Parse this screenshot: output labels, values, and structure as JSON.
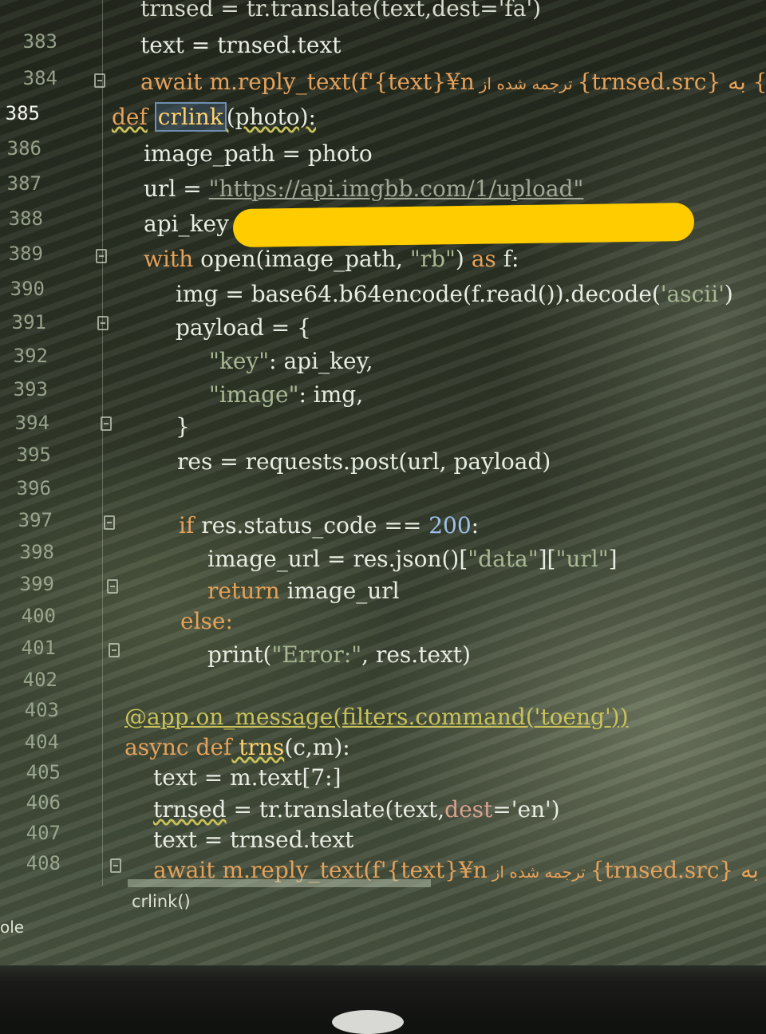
{
  "editor": {
    "line_numbers": [
      "383",
      "384",
      "385",
      "386",
      "387",
      "388",
      "389",
      "390",
      "391",
      "392",
      "393",
      "394",
      "395",
      "396",
      "397",
      "398",
      "399",
      "400",
      "401",
      "402",
      "403",
      "404",
      "405",
      "406",
      "407",
      "408"
    ],
    "lines": {
      "l382": "trnsed = tr.translate(text,dest='fa')",
      "l383": "text = trnsed.text",
      "l384_a": "await m.reply_text(f'{text}¥n",
      "l384_b": "ترجمه شده از",
      "l384_c": "{trnsed.src} به {tr",
      "l385_def": "def",
      "l385_name": "crlink",
      "l385_rest": "(photo):",
      "l386": "image_path = photo",
      "l387_a": "url = ",
      "l387_b": "\"https://api.imgbb.com/1/upload\"",
      "l388": "api_key = ",
      "l389_a": "with",
      "l389_b": " open(image_path, ",
      "l389_c": "\"rb\"",
      "l389_d": ") ",
      "l389_e": "as",
      "l389_f": " f:",
      "l390_a": "img = base64.b64encode(f.read()).decode(",
      "l390_b": "'ascii'",
      "l390_c": ")",
      "l391": "payload = {",
      "l392_a": "\"key\"",
      "l392_b": ": api_key,",
      "l393_a": "\"image\"",
      "l393_b": ": img,",
      "l394": "}",
      "l395": "res = requests.post(url, payload)",
      "l397_a": "if",
      "l397_b": " res.status_code == ",
      "l397_c": "200",
      "l397_d": ":",
      "l398_a": "image_url = res.json()[",
      "l398_b": "\"data\"",
      "l398_c": "][",
      "l398_d": "\"url\"",
      "l398_e": "]",
      "l399_a": "return",
      "l399_b": " image_url",
      "l400": "else:",
      "l401_a": "print(",
      "l401_b": "\"Error:\"",
      "l401_c": ", res.text)",
      "l403_a": "@app.on_message(filters.command(",
      "l403_b": "'toeng'",
      "l403_c": "))",
      "l404_a": "async def",
      "l404_b": " trns",
      "l404_c": "(c,m):",
      "l405": "text = m.text[7:]",
      "l406_a": "trnsed",
      "l406_b": " = tr.translate(text,",
      "l406_c": "dest",
      "l406_d": "='en')",
      "l407": "text = trnsed.text",
      "l408_a": "await m.reply_text(f'{text}¥n",
      "l408_b": "ترجمه شده از",
      "l408_c": "{trnsed.src} به {trnse"
    },
    "breadcrumb": "crlink()",
    "side_label": "ole"
  },
  "colors": {
    "keyword": "#e6a15a",
    "string": "#a8b894",
    "number": "#9fc0ea",
    "redaction": "#ffcc00"
  }
}
